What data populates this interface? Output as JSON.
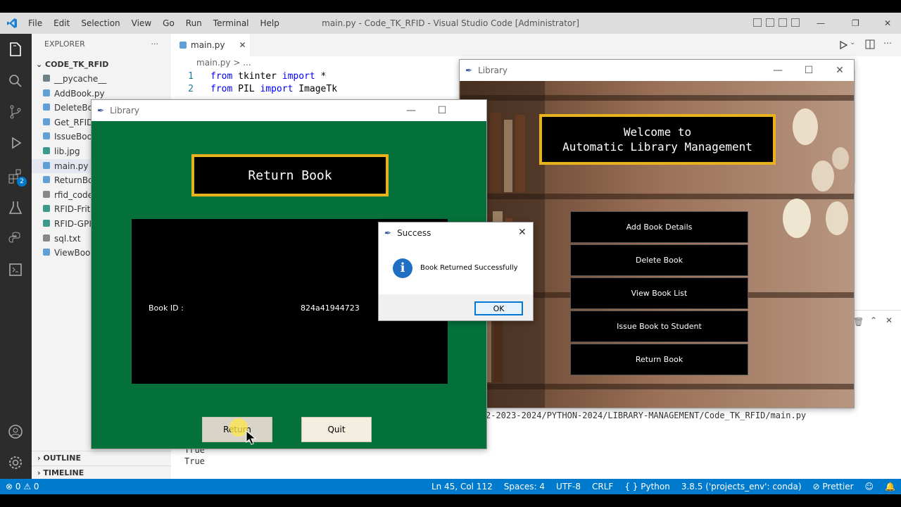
{
  "vscode": {
    "menu": [
      "File",
      "Edit",
      "Selection",
      "View",
      "Go",
      "Run",
      "Terminal",
      "Help"
    ],
    "title": "main.py - Code_TK_RFID - Visual Studio Code [Administrator]",
    "explorer_label": "EXPLORER",
    "explorer_more": "···",
    "project": "CODE_TK_RFID",
    "files": [
      "__pycache__",
      "AddBook.py",
      "DeleteBoo",
      "Get_RFID_",
      "IssueBook",
      "lib.jpg",
      "main.py",
      "ReturnBoo",
      "rfid_code_",
      "RFID-Fritz",
      "RFID-GPIO",
      "sql.txt",
      "ViewBook"
    ],
    "outline": "OUTLINE",
    "timeline": "TIMELINE",
    "tab": "main.py",
    "breadcrumb": "main.py > ...",
    "code": [
      {
        "ln": "1",
        "kw1": "from",
        "mod": " tkinter ",
        "kw2": "import",
        "rest": " *"
      },
      {
        "ln": "2",
        "kw1": "from",
        "mod": " PIL ",
        "kw2": "import",
        "rest": " ImageTk"
      }
    ],
    "terminal": [
      "2-2023-2024/PYTHON-2024/LIBRARY-MANAGEMENT/Code_TK_RFID/main.py",
      "True",
      "True"
    ],
    "activity_badge": "2",
    "status": {
      "errors": "0",
      "warnings": "0",
      "position": "Ln 45, Col 112",
      "spaces": "Spaces: 4",
      "encoding": "UTF-8",
      "eol": "CRLF",
      "language": "Python",
      "interpreter": "3.8.5 ('projects_env': conda)",
      "prettier": "Prettier"
    }
  },
  "return_window": {
    "title": "Library",
    "heading": "Return Book",
    "book_id_label": "Book ID :",
    "book_id_value": "824a41944723",
    "return_button": "Return",
    "quit_button": "Quit"
  },
  "library_window": {
    "title": "Library",
    "welcome_line1": "Welcome to",
    "welcome_line2": "Automatic Library Management",
    "buttons": [
      "Add Book Details",
      "Delete Book",
      "View Book List",
      "Issue Book to Student",
      "Return Book"
    ]
  },
  "message_box": {
    "title": "Success",
    "message": "Book Returned Successfully",
    "ok": "OK"
  },
  "colors": {
    "green_bg": "#04703a",
    "gold_border": "#e8b21f",
    "statusbar": "#007acc"
  }
}
